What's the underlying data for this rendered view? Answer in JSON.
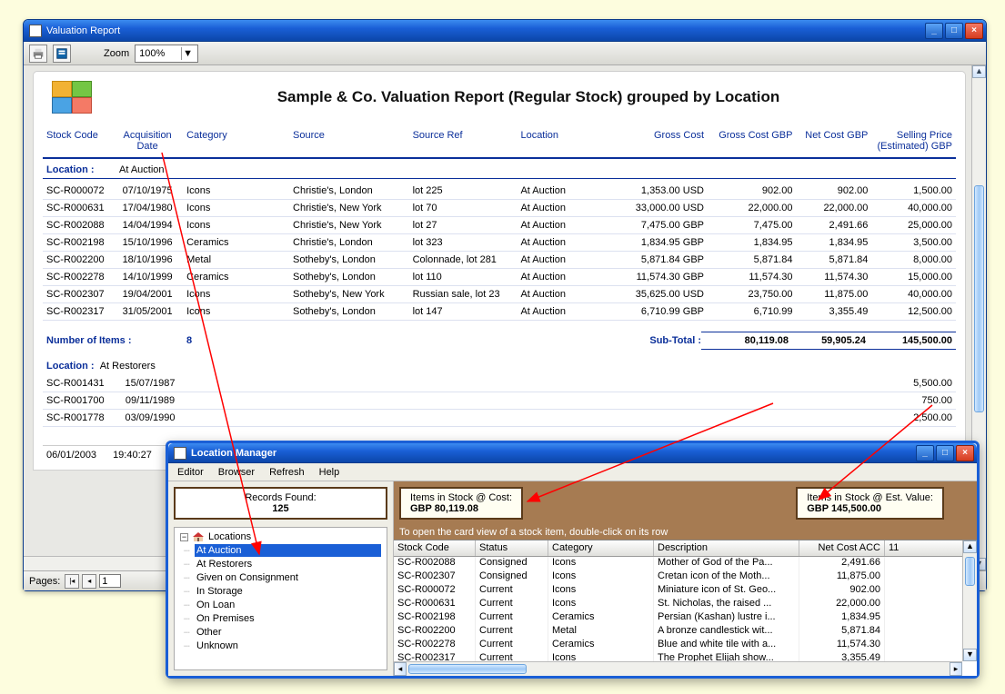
{
  "report_window": {
    "title": "Valuation Report",
    "toolbar": {
      "zoom_label": "Zoom",
      "zoom_value": "100%"
    },
    "report_title": "Sample & Co. Valuation Report (Regular Stock) grouped by Location",
    "columns": {
      "stock_code": "Stock Code",
      "acq_date": "Acquisition Date",
      "category": "Category",
      "source": "Source",
      "source_ref": "Source Ref",
      "location": "Location",
      "gross_cost": "Gross Cost",
      "gross_cost_gbp": "Gross Cost GBP",
      "net_cost_gbp": "Net Cost GBP",
      "sell_price": "Selling Price (Estimated) GBP"
    },
    "group1": {
      "location_label": "Location :",
      "location_value": "At Auction",
      "rows": [
        {
          "code": "SC-R000072",
          "date": "07/10/1975",
          "cat": "Icons",
          "src": "Christie's, London",
          "ref": "lot 225",
          "loc": "At Auction",
          "gross": "1,353.00 USD",
          "gbp": "902.00",
          "net": "902.00",
          "sell": "1,500.00"
        },
        {
          "code": "SC-R000631",
          "date": "17/04/1980",
          "cat": "Icons",
          "src": "Christie's, New York",
          "ref": "lot 70",
          "loc": "At Auction",
          "gross": "33,000.00 USD",
          "gbp": "22,000.00",
          "net": "22,000.00",
          "sell": "40,000.00"
        },
        {
          "code": "SC-R002088",
          "date": "14/04/1994",
          "cat": "Icons",
          "src": "Christie's, New York",
          "ref": "lot 27",
          "loc": "At Auction",
          "gross": "7,475.00 GBP",
          "gbp": "7,475.00",
          "net": "2,491.66",
          "sell": "25,000.00"
        },
        {
          "code": "SC-R002198",
          "date": "15/10/1996",
          "cat": "Ceramics",
          "src": "Christie's, London",
          "ref": "lot 323",
          "loc": "At Auction",
          "gross": "1,834.95 GBP",
          "gbp": "1,834.95",
          "net": "1,834.95",
          "sell": "3,500.00"
        },
        {
          "code": "SC-R002200",
          "date": "18/10/1996",
          "cat": "Metal",
          "src": "Sotheby's, London",
          "ref": "Colonnade, lot 281",
          "loc": "At Auction",
          "gross": "5,871.84 GBP",
          "gbp": "5,871.84",
          "net": "5,871.84",
          "sell": "8,000.00"
        },
        {
          "code": "SC-R002278",
          "date": "14/10/1999",
          "cat": "Ceramics",
          "src": "Sotheby's, London",
          "ref": "lot 110",
          "loc": "At Auction",
          "gross": "11,574.30 GBP",
          "gbp": "11,574.30",
          "net": "11,574.30",
          "sell": "15,000.00"
        },
        {
          "code": "SC-R002307",
          "date": "19/04/2001",
          "cat": "Icons",
          "src": "Sotheby's, New York",
          "ref": "Russian sale, lot 23",
          "loc": "At Auction",
          "gross": "35,625.00 USD",
          "gbp": "23,750.00",
          "net": "11,875.00",
          "sell": "40,000.00"
        },
        {
          "code": "SC-R002317",
          "date": "31/05/2001",
          "cat": "Icons",
          "src": "Sotheby's, London",
          "ref": "lot 147",
          "loc": "At Auction",
          "gross": "6,710.99 GBP",
          "gbp": "6,710.99",
          "net": "3,355.49",
          "sell": "12,500.00"
        }
      ],
      "count_label": "Number of Items :",
      "count_value": "8",
      "subtotal_label": "Sub-Total :",
      "subtotal_gbp": "80,119.08",
      "subtotal_net": "59,905.24",
      "subtotal_sell": "145,500.00"
    },
    "group2": {
      "location_label": "Location :",
      "location_value": "At Restorers",
      "partial_rows": [
        {
          "code": "SC-R001431",
          "date": "15/07/1987",
          "sell": "5,500.00"
        },
        {
          "code": "SC-R001700",
          "date": "09/11/1989",
          "sell": "750.00"
        },
        {
          "code": "SC-R001778",
          "date": "03/09/1990",
          "sell": "2,500.00"
        }
      ]
    },
    "footer_date": "06/01/2003",
    "footer_time": "19:40:27",
    "pager_label": "Pages:",
    "pager_value": "1"
  },
  "locmgr": {
    "title": "Location Manager",
    "menu": {
      "editor": "Editor",
      "browser": "Browser",
      "refresh": "Refresh",
      "help": "Help"
    },
    "records_label": "Records Found:",
    "records_value": "125",
    "tree_root": "Locations",
    "tree_items": [
      "At Auction",
      "At Restorers",
      "Given on Consignment",
      "In Storage",
      "On Loan",
      "On Premises",
      "Other",
      "Unknown"
    ],
    "tree_selected": "At Auction",
    "box1_label": "Items in Stock @ Cost:",
    "box1_value": "GBP  80,119.08",
    "box2_label": "Items in Stock @ Est. Value:",
    "box2_value": "GBP  145,500.00",
    "hint": "To open the card view of a stock item, double-click on its row",
    "grid_cols": {
      "c1": "Stock Code",
      "c2": "Status",
      "c3": "Category",
      "c4": "Description",
      "c5": "Net Cost ACC"
    },
    "grid_extra_col": "11",
    "grid_rows": [
      {
        "code": "SC-R002088",
        "status": "Consigned",
        "cat": "Icons",
        "desc": "Mother of God of the Pa...",
        "net": "2,491.66"
      },
      {
        "code": "SC-R002307",
        "status": "Consigned",
        "cat": "Icons",
        "desc": "Cretan icon of the Moth...",
        "net": "11,875.00"
      },
      {
        "code": "SC-R000072",
        "status": "Current",
        "cat": "Icons",
        "desc": "Miniature icon of St. Geo...",
        "net": "902.00"
      },
      {
        "code": "SC-R000631",
        "status": "Current",
        "cat": "Icons",
        "desc": "St. Nicholas, the raised ...",
        "net": "22,000.00"
      },
      {
        "code": "SC-R002198",
        "status": "Current",
        "cat": "Ceramics",
        "desc": "Persian (Kashan) lustre i...",
        "net": "1,834.95"
      },
      {
        "code": "SC-R002200",
        "status": "Current",
        "cat": "Metal",
        "desc": "A bronze candlestick wit...",
        "net": "5,871.84"
      },
      {
        "code": "SC-R002278",
        "status": "Current",
        "cat": "Ceramics",
        "desc": "Blue and white tile with a...",
        "net": "11,574.30"
      },
      {
        "code": "SC-R002317",
        "status": "Current",
        "cat": "Icons",
        "desc": "The Prophet Elijah show...",
        "net": "3,355.49"
      }
    ]
  }
}
